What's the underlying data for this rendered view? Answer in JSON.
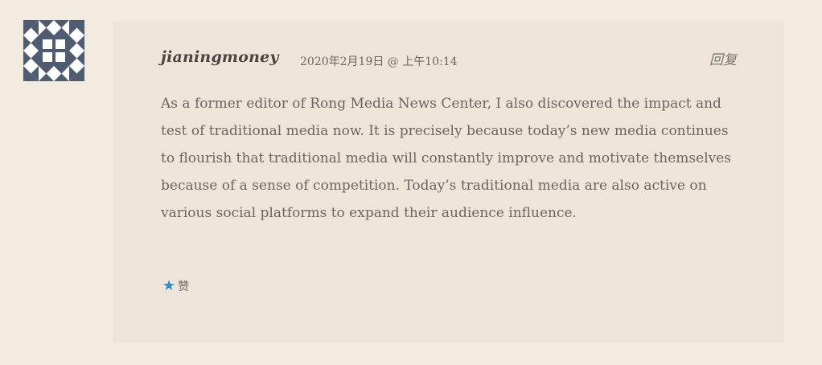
{
  "comment": {
    "author": "jianingmoney",
    "timestamp": "2020年2月19日 @ 上午10:14",
    "reply_label": "回复",
    "body": "As a former editor of Rong Media News Center, I also discovered the impact and test of traditional media now. It is precisely because today’s new media continues to flourish that traditional media will constantly improve and motivate themselves because of a sense of competition. Today’s traditional media are also active on various social platforms to expand their audience influence.",
    "like_icon": "★",
    "like_label": "赞"
  },
  "colors": {
    "page_background": "#f2eadf",
    "card_background": "#ede5da",
    "avatar_pattern": "#4f5b70",
    "like_star": "#2d8ec9"
  },
  "icons": {
    "avatar": "identicon-avatar",
    "like": "star-icon"
  }
}
